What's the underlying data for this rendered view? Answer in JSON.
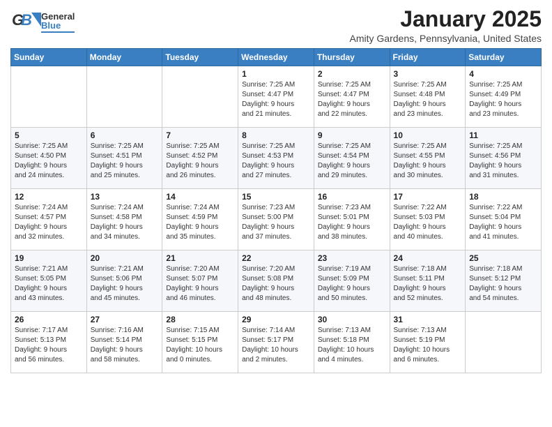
{
  "header": {
    "logo_general": "General",
    "logo_blue": "Blue",
    "month": "January 2025",
    "location": "Amity Gardens, Pennsylvania, United States"
  },
  "weekdays": [
    "Sunday",
    "Monday",
    "Tuesday",
    "Wednesday",
    "Thursday",
    "Friday",
    "Saturday"
  ],
  "weeks": [
    [
      {
        "day": "",
        "info": ""
      },
      {
        "day": "",
        "info": ""
      },
      {
        "day": "",
        "info": ""
      },
      {
        "day": "1",
        "info": "Sunrise: 7:25 AM\nSunset: 4:47 PM\nDaylight: 9 hours\nand 21 minutes."
      },
      {
        "day": "2",
        "info": "Sunrise: 7:25 AM\nSunset: 4:47 PM\nDaylight: 9 hours\nand 22 minutes."
      },
      {
        "day": "3",
        "info": "Sunrise: 7:25 AM\nSunset: 4:48 PM\nDaylight: 9 hours\nand 23 minutes."
      },
      {
        "day": "4",
        "info": "Sunrise: 7:25 AM\nSunset: 4:49 PM\nDaylight: 9 hours\nand 23 minutes."
      }
    ],
    [
      {
        "day": "5",
        "info": "Sunrise: 7:25 AM\nSunset: 4:50 PM\nDaylight: 9 hours\nand 24 minutes."
      },
      {
        "day": "6",
        "info": "Sunrise: 7:25 AM\nSunset: 4:51 PM\nDaylight: 9 hours\nand 25 minutes."
      },
      {
        "day": "7",
        "info": "Sunrise: 7:25 AM\nSunset: 4:52 PM\nDaylight: 9 hours\nand 26 minutes."
      },
      {
        "day": "8",
        "info": "Sunrise: 7:25 AM\nSunset: 4:53 PM\nDaylight: 9 hours\nand 27 minutes."
      },
      {
        "day": "9",
        "info": "Sunrise: 7:25 AM\nSunset: 4:54 PM\nDaylight: 9 hours\nand 29 minutes."
      },
      {
        "day": "10",
        "info": "Sunrise: 7:25 AM\nSunset: 4:55 PM\nDaylight: 9 hours\nand 30 minutes."
      },
      {
        "day": "11",
        "info": "Sunrise: 7:25 AM\nSunset: 4:56 PM\nDaylight: 9 hours\nand 31 minutes."
      }
    ],
    [
      {
        "day": "12",
        "info": "Sunrise: 7:24 AM\nSunset: 4:57 PM\nDaylight: 9 hours\nand 32 minutes."
      },
      {
        "day": "13",
        "info": "Sunrise: 7:24 AM\nSunset: 4:58 PM\nDaylight: 9 hours\nand 34 minutes."
      },
      {
        "day": "14",
        "info": "Sunrise: 7:24 AM\nSunset: 4:59 PM\nDaylight: 9 hours\nand 35 minutes."
      },
      {
        "day": "15",
        "info": "Sunrise: 7:23 AM\nSunset: 5:00 PM\nDaylight: 9 hours\nand 37 minutes."
      },
      {
        "day": "16",
        "info": "Sunrise: 7:23 AM\nSunset: 5:01 PM\nDaylight: 9 hours\nand 38 minutes."
      },
      {
        "day": "17",
        "info": "Sunrise: 7:22 AM\nSunset: 5:03 PM\nDaylight: 9 hours\nand 40 minutes."
      },
      {
        "day": "18",
        "info": "Sunrise: 7:22 AM\nSunset: 5:04 PM\nDaylight: 9 hours\nand 41 minutes."
      }
    ],
    [
      {
        "day": "19",
        "info": "Sunrise: 7:21 AM\nSunset: 5:05 PM\nDaylight: 9 hours\nand 43 minutes."
      },
      {
        "day": "20",
        "info": "Sunrise: 7:21 AM\nSunset: 5:06 PM\nDaylight: 9 hours\nand 45 minutes."
      },
      {
        "day": "21",
        "info": "Sunrise: 7:20 AM\nSunset: 5:07 PM\nDaylight: 9 hours\nand 46 minutes."
      },
      {
        "day": "22",
        "info": "Sunrise: 7:20 AM\nSunset: 5:08 PM\nDaylight: 9 hours\nand 48 minutes."
      },
      {
        "day": "23",
        "info": "Sunrise: 7:19 AM\nSunset: 5:09 PM\nDaylight: 9 hours\nand 50 minutes."
      },
      {
        "day": "24",
        "info": "Sunrise: 7:18 AM\nSunset: 5:11 PM\nDaylight: 9 hours\nand 52 minutes."
      },
      {
        "day": "25",
        "info": "Sunrise: 7:18 AM\nSunset: 5:12 PM\nDaylight: 9 hours\nand 54 minutes."
      }
    ],
    [
      {
        "day": "26",
        "info": "Sunrise: 7:17 AM\nSunset: 5:13 PM\nDaylight: 9 hours\nand 56 minutes."
      },
      {
        "day": "27",
        "info": "Sunrise: 7:16 AM\nSunset: 5:14 PM\nDaylight: 9 hours\nand 58 minutes."
      },
      {
        "day": "28",
        "info": "Sunrise: 7:15 AM\nSunset: 5:15 PM\nDaylight: 10 hours\nand 0 minutes."
      },
      {
        "day": "29",
        "info": "Sunrise: 7:14 AM\nSunset: 5:17 PM\nDaylight: 10 hours\nand 2 minutes."
      },
      {
        "day": "30",
        "info": "Sunrise: 7:13 AM\nSunset: 5:18 PM\nDaylight: 10 hours\nand 4 minutes."
      },
      {
        "day": "31",
        "info": "Sunrise: 7:13 AM\nSunset: 5:19 PM\nDaylight: 10 hours\nand 6 minutes."
      },
      {
        "day": "",
        "info": ""
      }
    ]
  ]
}
